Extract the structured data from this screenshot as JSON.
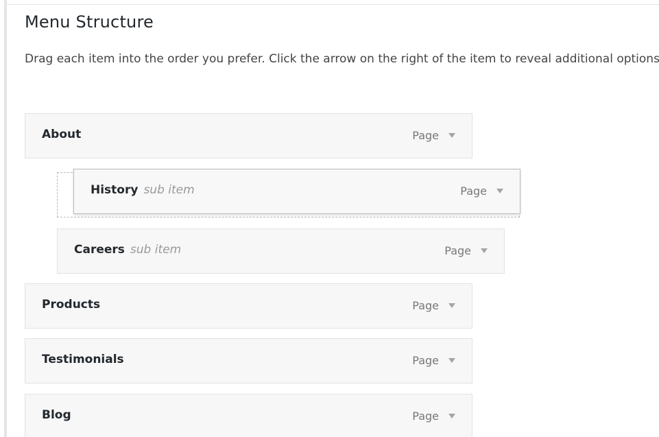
{
  "header": {
    "title": "Menu Structure",
    "description": "Drag each item into the order you prefer. Click the arrow on the right of the item to reveal additional options."
  },
  "menu": {
    "items": [
      {
        "label": "About",
        "sub_label": "",
        "type": "Page",
        "icon": "triangle-down-icon"
      },
      {
        "label": "History",
        "sub_label": "sub item",
        "type": "Page",
        "icon": "triangle-down-icon"
      },
      {
        "label": "Careers",
        "sub_label": "sub item",
        "type": "Page",
        "icon": "triangle-down-icon"
      },
      {
        "label": "Products",
        "sub_label": "",
        "type": "Page",
        "icon": "triangle-down-icon"
      },
      {
        "label": "Testimonials",
        "sub_label": "",
        "type": "Page",
        "icon": "triangle-down-icon"
      },
      {
        "label": "Blog",
        "sub_label": "",
        "type": "Page",
        "icon": "triangle-down-icon"
      }
    ]
  },
  "colors": {
    "item_background": "#f7f7f7",
    "item_border": "#e2e2e2",
    "arrow": "#a0a5aa",
    "sub_label": "#999999"
  }
}
